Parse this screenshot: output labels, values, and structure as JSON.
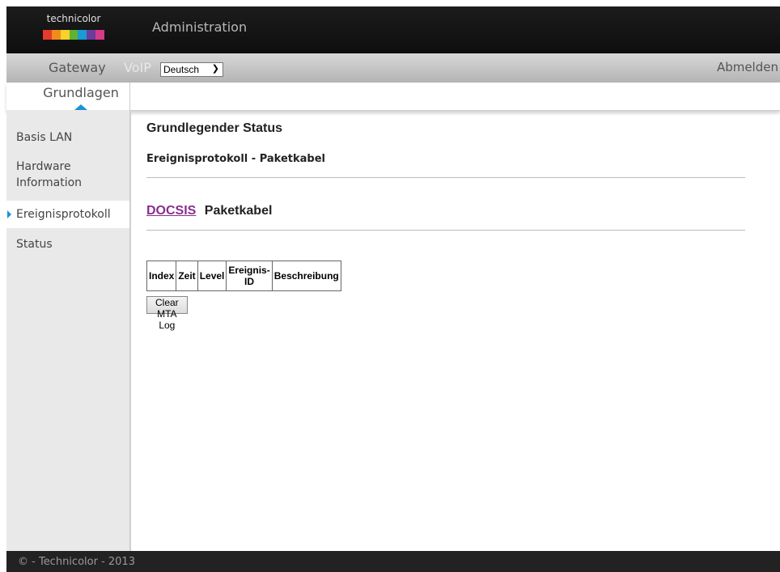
{
  "logo": {
    "text": "technicolor",
    "colors": [
      "#e63a2e",
      "#f18c1c",
      "#f6d22a",
      "#5fb32e",
      "#1b9ad6",
      "#6a3d9a",
      "#d63a8a"
    ]
  },
  "header": {
    "title": "Administration"
  },
  "menu": {
    "gateway": "Gateway",
    "voip": "VoIP",
    "language": "Deutsch",
    "logout": "Abmelden"
  },
  "subnav": {
    "active_tab": "Grundlagen"
  },
  "sidebar": {
    "items": [
      {
        "label": "Basis LAN"
      },
      {
        "label": "Hardware Information"
      },
      {
        "label": "Ereignisprotokoll",
        "active": true
      },
      {
        "label": "Status"
      }
    ]
  },
  "main": {
    "title": "Grundlegender Status",
    "subtitle": "Ereignisprotokoll - Paketkabel",
    "tabs": {
      "docsis": "DOCSIS",
      "paketkabel": "Paketkabel"
    },
    "table": {
      "columns": [
        "Index",
        "Zeit",
        "Level",
        "Ereignis-ID",
        "Beschreibung"
      ]
    },
    "clear_button": "Clear MTA Log"
  },
  "footer": {
    "copyright": "© - Technicolor - 2013"
  },
  "colors": {
    "accent": "#1e90d8",
    "link": "#8a2d8e",
    "topbar": "#151515"
  }
}
